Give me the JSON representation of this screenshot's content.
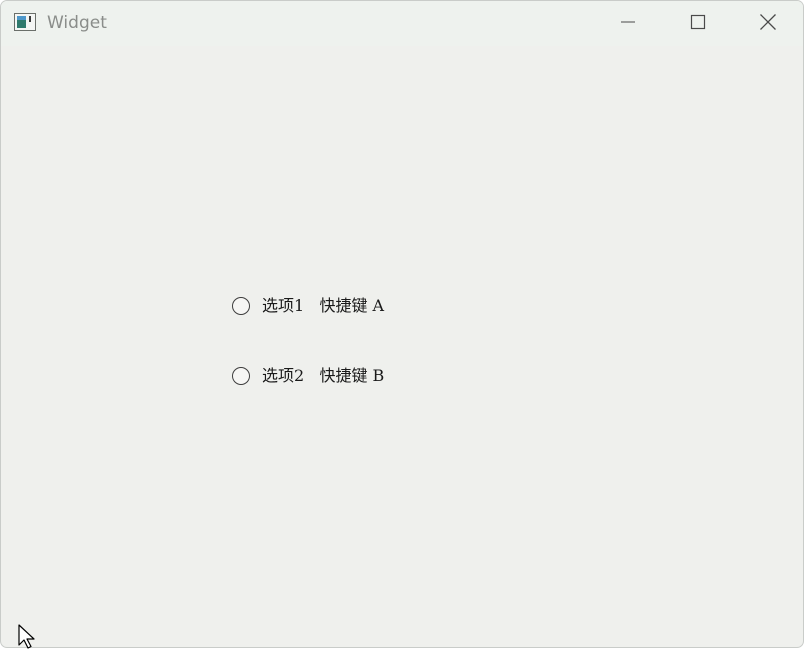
{
  "window": {
    "title": "Widget",
    "icon": "app-window-icon",
    "controls": {
      "minimize_icon": "minimize-icon",
      "maximize_icon": "maximize-icon",
      "close_icon": "close-icon"
    }
  },
  "options": [
    {
      "label": "选项1   快捷键 A",
      "checked": false
    },
    {
      "label": "选项2   快捷键 B",
      "checked": false
    }
  ],
  "colors": {
    "background": "#eff0ed",
    "titlebar": "#eef2ee",
    "title_text": "#8a8d8a",
    "text": "#1a1a1a"
  }
}
